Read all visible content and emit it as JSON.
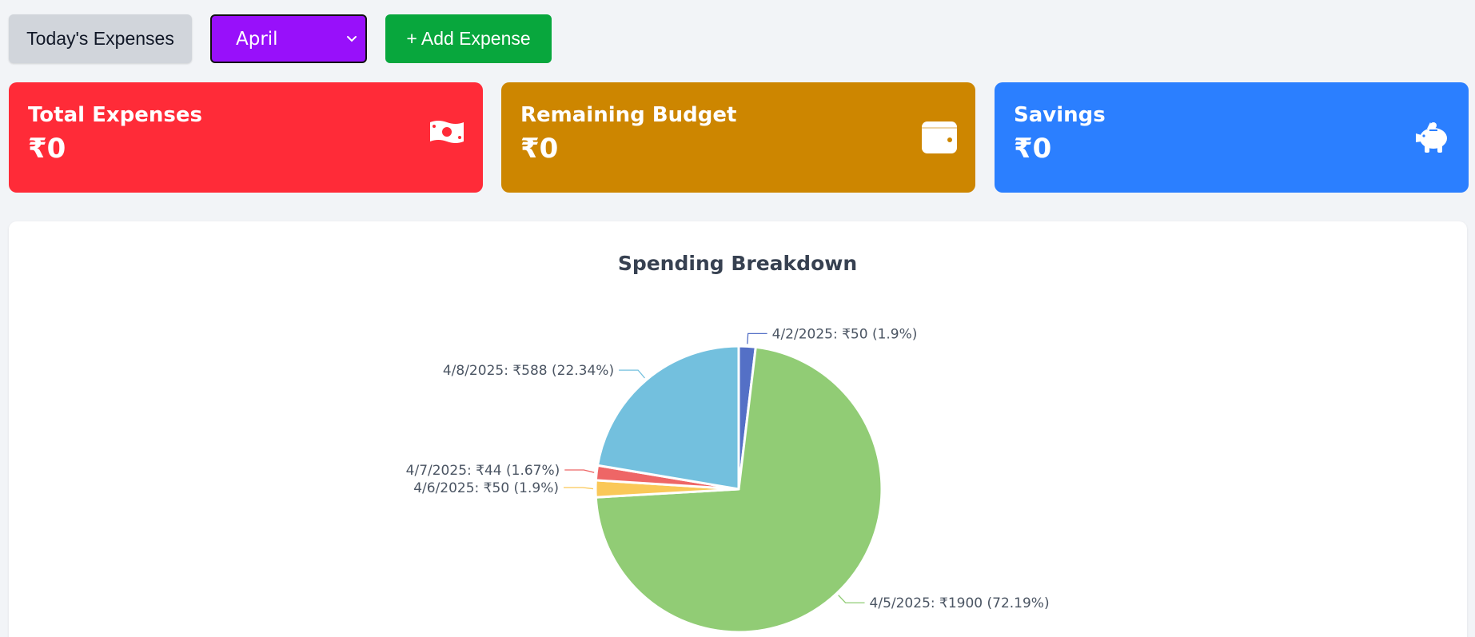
{
  "toolbar": {
    "today_label": "Today's Expenses",
    "month_selected": "April",
    "add_label": "+ Add Expense"
  },
  "cards": [
    {
      "title": "Total Expenses",
      "value": "₹0",
      "icon": "money-bill-icon",
      "color": "#ff2b38"
    },
    {
      "title": "Remaining Budget",
      "value": "₹0",
      "icon": "wallet-icon",
      "color": "#cd8600"
    },
    {
      "title": "Savings",
      "value": "₹0",
      "icon": "piggy-bank-icon",
      "color": "#2b7fff"
    }
  ],
  "chart_data": {
    "type": "pie",
    "title": "Spending Breakdown",
    "slices": [
      {
        "label": "4/2/2025: ₹50 (1.9%)",
        "value": 50,
        "percent": 1.9,
        "color": "#5470c6"
      },
      {
        "label": "4/5/2025: ₹1900 (72.19%)",
        "value": 1900,
        "percent": 72.19,
        "color": "#91cc75"
      },
      {
        "label": "4/6/2025: ₹50 (1.9%)",
        "value": 50,
        "percent": 1.9,
        "color": "#fac858"
      },
      {
        "label": "4/7/2025: ₹44 (1.67%)",
        "value": 44,
        "percent": 1.67,
        "color": "#ee6666"
      },
      {
        "label": "4/8/2025: ₹588 (22.34%)",
        "value": 588,
        "percent": 22.34,
        "color": "#73c0de"
      }
    ]
  }
}
